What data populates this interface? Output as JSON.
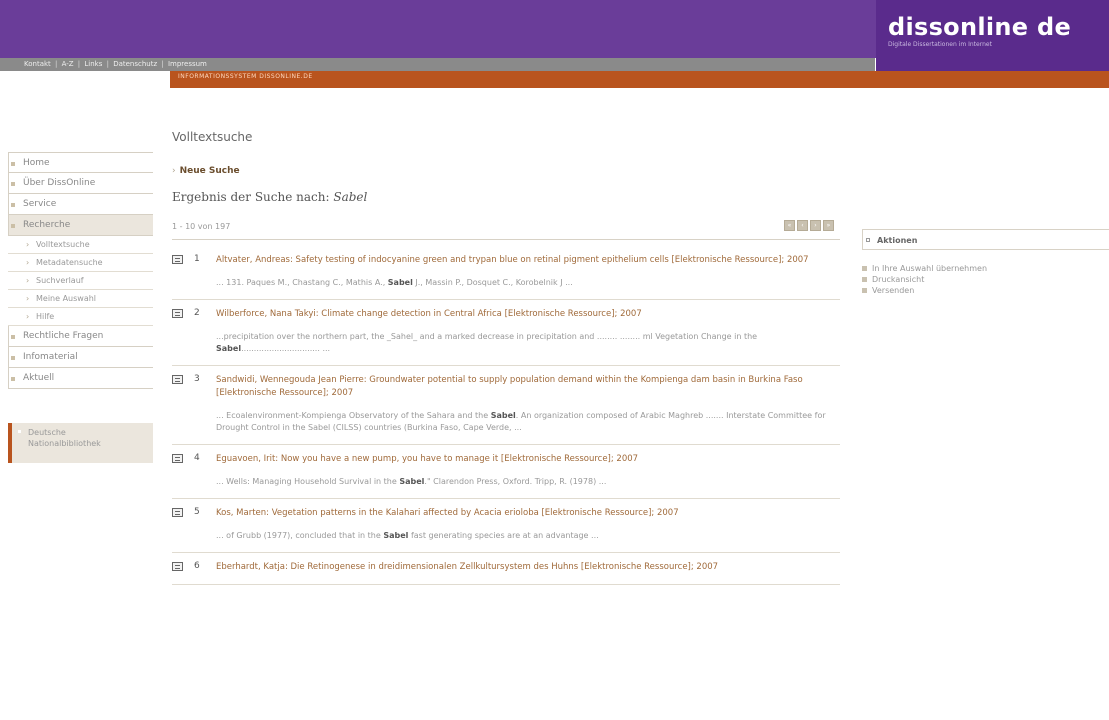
{
  "header": {
    "logo": "dissonline de",
    "logo_sub": "Digitale Dissertationen im Internet",
    "band_text": "INFORMATIONSSYSTEM DISSONLINE.DE",
    "topnav": [
      "Kontakt",
      "A-Z",
      "Links",
      "Datenschutz",
      "Impressum"
    ]
  },
  "sidebar": {
    "items": [
      {
        "label": "Home",
        "active": false
      },
      {
        "label": "Über DissOnline",
        "active": false
      },
      {
        "label": "Service",
        "active": false
      },
      {
        "label": "Recherche",
        "active": true
      }
    ],
    "subitems": [
      "Volltextsuche",
      "Metadatensuche",
      "Suchverlauf",
      "Meine Auswahl",
      "Hilfe"
    ],
    "items_after": [
      "Rechtliche Fragen",
      "Infomaterial",
      "Aktuell"
    ],
    "dnb": [
      "Deutsche",
      "Nationalbibliothek"
    ]
  },
  "main": {
    "title": "Volltextsuche",
    "new_search": "Neue Suche",
    "results_prefix": "Ergebnis der Suche nach:",
    "search_term": "Sabel",
    "count": "1 - 10 von 197",
    "pager": [
      "«",
      "‹",
      "›",
      "»"
    ],
    "results": [
      {
        "num": "1",
        "title": "Altvater, Andreas: Safety testing of indocyanine green and trypan blue on retinal pigment epithelium cells [Elektronische Ressource]; 2007",
        "snip_pre": "... 131. Paques M., Chastang C., Mathis A., ",
        "snip_bold": "Sabel",
        "snip_post": " J., Massin P., Dosquet C., Korobelnik J ..."
      },
      {
        "num": "2",
        "title": "Wilberforce, Nana Takyi: Climate change detection in Central Africa [Elektronische Ressource]; 2007",
        "snip_pre": "...precipitation over the northern part, the _Sahel_ and a marked decrease in precipitation and ........ ........ ml Vegetation Change in the ",
        "snip_bold": "Sabel",
        "snip_post": "............................... ..."
      },
      {
        "num": "3",
        "title": "Sandwidi, Wennegouda Jean Pierre: Groundwater potential to supply population demand within the Kompienga dam basin in Burkina Faso [Elektronische Ressource]; 2007",
        "snip_pre": "... Ecoalenvironment-Kompienga Observatory of the Sahara and the ",
        "snip_bold": "Sabel",
        "snip_post": ". An organization composed of Arabic Maghreb ....... Interstate Committee for Drought Control in the Sabel (CILSS) countries (Burkina Faso, Cape Verde, ..."
      },
      {
        "num": "4",
        "title": "Eguavoen, Irit: Now you have a new pump, you have to manage it [Elektronische Ressource]; 2007",
        "snip_pre": "... Wells: Managing Household Survival in the ",
        "snip_bold": "Sabel",
        "snip_post": ".\" Clarendon Press, Oxford. Tripp, R. (1978) ..."
      },
      {
        "num": "5",
        "title": "Kos, Marten: Vegetation patterns in the Kalahari affected by Acacia erioloba [Elektronische Ressource]; 2007",
        "snip_pre": "... of Grubb (1977), concluded that in the ",
        "snip_bold": "Sabel",
        "snip_post": " fast generating species are at an advantage ..."
      },
      {
        "num": "6",
        "title": "Eberhardt, Katja: Die Retinogenese in dreidimensionalen Zellkultursystem des Huhns [Elektronische Ressource]; 2007",
        "snip_pre": "",
        "snip_bold": "",
        "snip_post": ""
      }
    ]
  },
  "actions": {
    "title": "Aktionen",
    "items": [
      "In Ihre Auswahl übernehmen",
      "Druckansicht",
      "Versenden"
    ]
  }
}
